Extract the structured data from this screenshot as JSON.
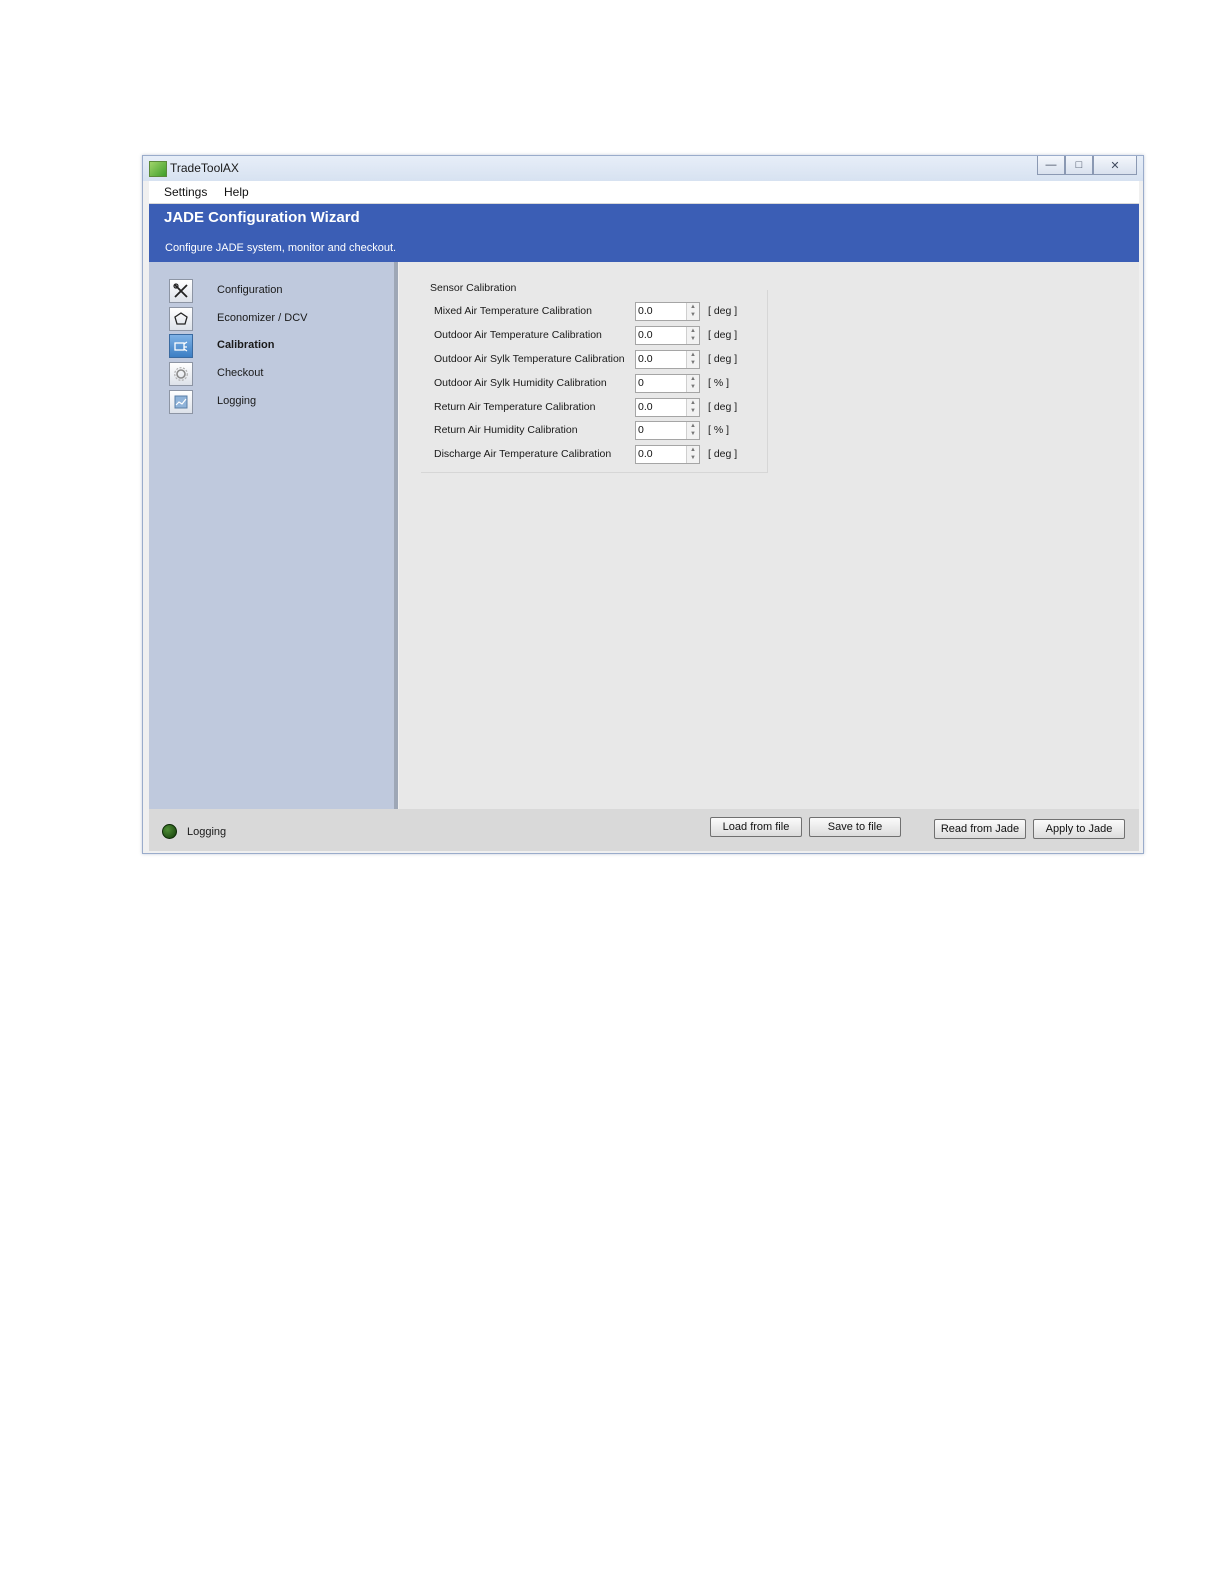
{
  "window": {
    "title": "TradeToolAX"
  },
  "menu": {
    "settings": "Settings",
    "help": "Help"
  },
  "banner": {
    "title": "JADE Configuration Wizard",
    "subtitle": "Configure JADE system, monitor and checkout."
  },
  "sidebar": {
    "items": [
      {
        "label": "Configuration",
        "icon": "tools-icon",
        "active": false
      },
      {
        "label": "Economizer / DCV",
        "icon": "economizer-icon",
        "active": false
      },
      {
        "label": "Calibration",
        "icon": "calibration-icon",
        "active": true
      },
      {
        "label": "Checkout",
        "icon": "gear-icon",
        "active": false
      },
      {
        "label": "Logging",
        "icon": "logging-icon",
        "active": false
      }
    ]
  },
  "calibration": {
    "group_title": "Sensor Calibration",
    "rows": [
      {
        "label": "Mixed Air Temperature Calibration",
        "value": "0.0",
        "unit": "[ deg ]"
      },
      {
        "label": "Outdoor Air Temperature Calibration",
        "value": "0.0",
        "unit": "[ deg ]"
      },
      {
        "label": "Outdoor Air Sylk Temperature Calibration",
        "value": "0.0",
        "unit": "[ deg ]"
      },
      {
        "label": "Outdoor Air Sylk Humidity Calibration",
        "value": "0",
        "unit": "[ % ]"
      },
      {
        "label": "Return Air Temperature Calibration",
        "value": "0.0",
        "unit": "[ deg ]"
      },
      {
        "label": "Return Air  Humidity Calibration",
        "value": "0",
        "unit": "[ % ]"
      },
      {
        "label": "Discharge Air Temperature Calibration",
        "value": "0.0",
        "unit": "[ deg ]"
      }
    ]
  },
  "status": {
    "text": "Logging",
    "led_color": "#2f6b1f"
  },
  "buttons": {
    "load": "Load from file",
    "save": "Save to  file",
    "read": "Read from Jade",
    "apply": "Apply to Jade"
  },
  "colors": {
    "banner": "#3b5eb5",
    "sidebar": "#bfc9dd",
    "content": "#e8e8e8"
  }
}
